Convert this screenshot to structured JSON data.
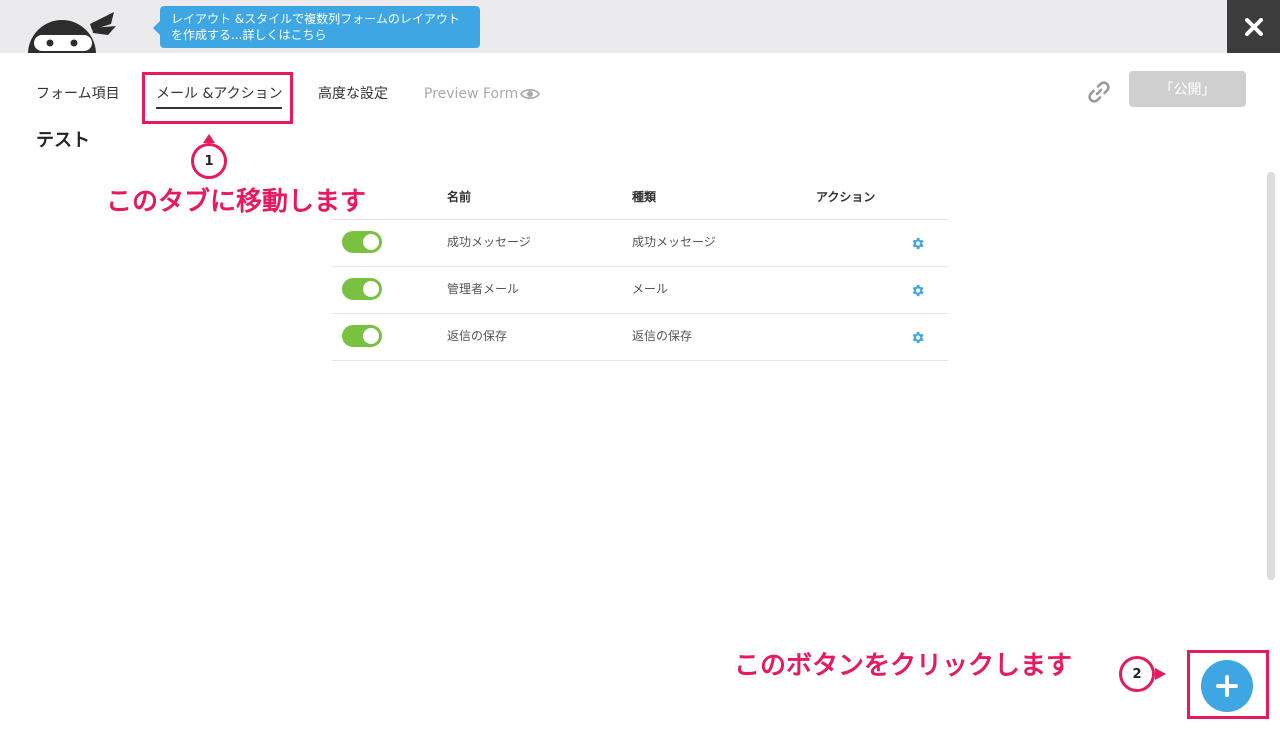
{
  "topbar": {
    "tip_line1": "レイアウト &スタイルで複数列フォームのレイアウト",
    "tip_line2": "を作成する...詳しくはこちら",
    "close_icon": "close-icon"
  },
  "tabs": [
    {
      "label": "フォーム項目"
    },
    {
      "label": "メール &アクション",
      "active": true
    },
    {
      "label": "高度な設定"
    },
    {
      "label": "Preview Form",
      "icon": "eye-icon"
    }
  ],
  "header": {
    "publish_label": "「公開」",
    "link_icon": "link-icon",
    "form_title": "テスト"
  },
  "table": {
    "headers": [
      "名前",
      "種類",
      "アクション"
    ],
    "rows": [
      {
        "enabled": true,
        "name": "成功メッセージ",
        "type": "成功メッセージ"
      },
      {
        "enabled": true,
        "name": "管理者メール",
        "type": "メール"
      },
      {
        "enabled": true,
        "name": "返信の保存",
        "type": "返信の保存"
      }
    ]
  },
  "annotations": {
    "step1_number": "1",
    "step1_text": "このタブに移動します",
    "step2_number": "2",
    "step2_text": "このボタンをクリックします"
  },
  "colors": {
    "accent_blue": "#3ea6e2",
    "toggle_green": "#7ac142",
    "highlight_pink": "#e8195f",
    "close_bg": "#3c3c3c",
    "topbar_bg": "#ebebed"
  }
}
